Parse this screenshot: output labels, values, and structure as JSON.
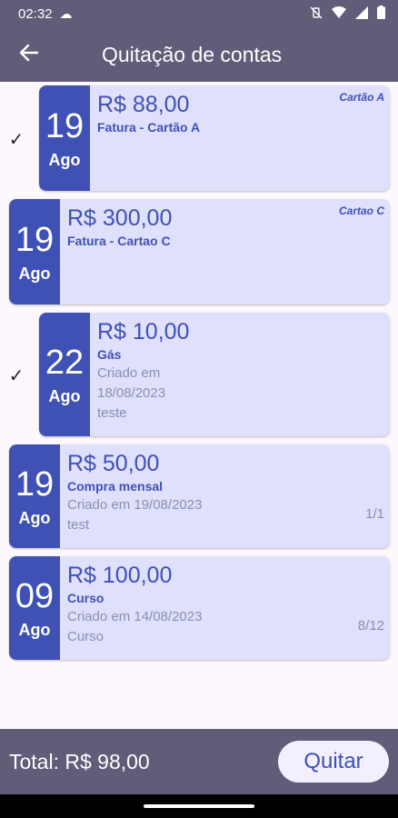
{
  "status": {
    "time": "02:32"
  },
  "appbar": {
    "title": "Quitação de contas"
  },
  "items": [
    {
      "checked": true,
      "day": "19",
      "month": "Ago",
      "amount": "R$ 88,00",
      "name": "Fatura - Cartão A",
      "tag": "Cartão A"
    },
    {
      "checked": false,
      "day": "19",
      "month": "Ago",
      "amount": "R$ 300,00",
      "name": "Fatura - Cartao C",
      "tag": "Cartao C"
    },
    {
      "checked": true,
      "day": "22",
      "month": "Ago",
      "amount": "R$ 10,00",
      "name": "Gás",
      "line1": "Criado em",
      "line2": "18/08/2023",
      "line3": "teste"
    },
    {
      "checked": false,
      "day": "19",
      "month": "Ago",
      "amount": "R$ 50,00",
      "name": "Compra mensal",
      "line1": "Criado em 19/08/2023",
      "line2": "test",
      "count": "1/1"
    },
    {
      "checked": false,
      "day": "09",
      "month": "Ago",
      "amount": "R$ 100,00",
      "name": "Curso",
      "line1": "Criado em 14/08/2023",
      "line2": "Curso",
      "count": "8/12"
    }
  ],
  "footer": {
    "total": "Total: R$ 98,00",
    "pay_label": "Quitar"
  },
  "icons": {
    "back": "arrow-left-icon",
    "check": "check-icon",
    "cloud": "cloud-icon",
    "mute": "vibrate-off-icon",
    "wifi": "wifi-icon",
    "signal": "signal-icon",
    "battery": "battery-icon"
  },
  "colors": {
    "primary": "#3f51b5",
    "card": "#dfe0fb",
    "appbar": "#5f5d78",
    "background": "#fdf8fd"
  }
}
